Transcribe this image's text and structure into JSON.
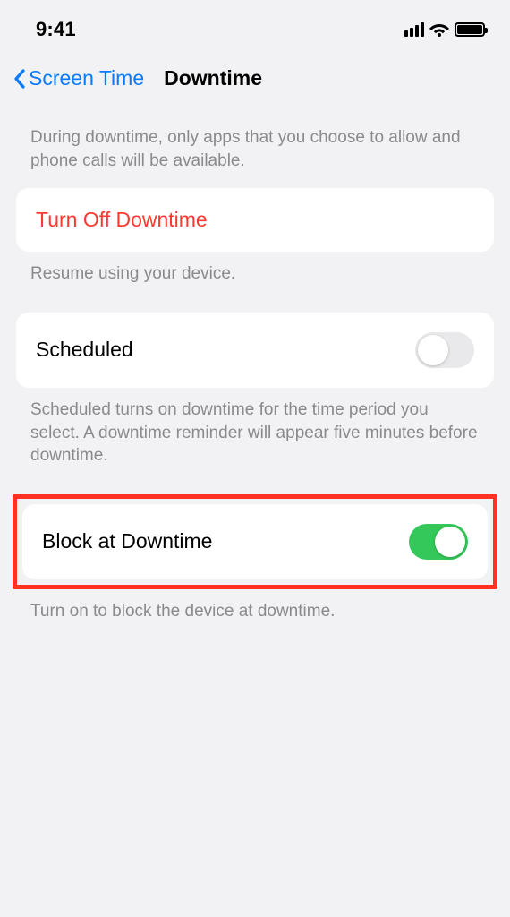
{
  "statusBar": {
    "time": "9:41"
  },
  "nav": {
    "backLabel": "Screen Time",
    "title": "Downtime"
  },
  "intro": "During downtime, only apps that you choose to allow and phone calls will be available.",
  "turnOff": {
    "label": "Turn Off Downtime",
    "footer": "Resume using your device."
  },
  "scheduled": {
    "label": "Scheduled",
    "on": false,
    "footer": "Scheduled turns on downtime for the time period you select. A downtime reminder will appear five minutes before downtime."
  },
  "blockAtDowntime": {
    "label": "Block at Downtime",
    "on": true,
    "footer": "Turn on to block the device at downtime."
  }
}
